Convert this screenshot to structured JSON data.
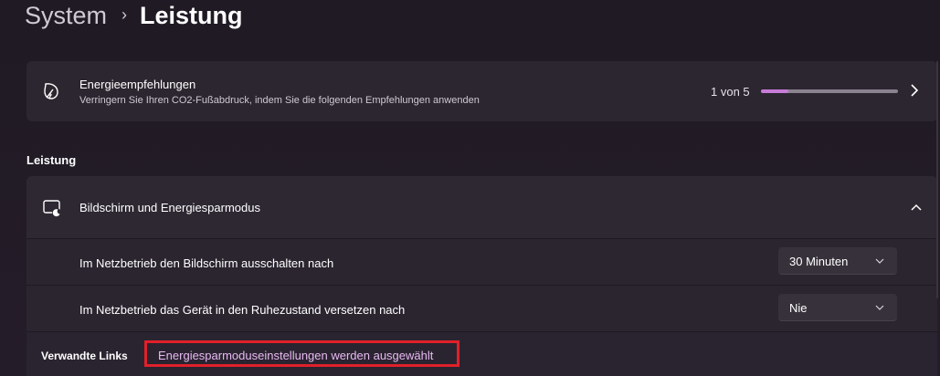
{
  "breadcrumb": {
    "parent": "System",
    "separator": "›",
    "current": "Leistung"
  },
  "recommendations": {
    "icon": "leaf-energy-icon",
    "title": "Energieempfehlungen",
    "subtitle": "Verringern Sie Ihren CO2-Fußabdruck, indem Sie die folgenden Empfehlungen anwenden",
    "count": "1 von 5",
    "progress_fraction": 0.2,
    "accent": "#c77bd8"
  },
  "section": {
    "heading": "Leistung"
  },
  "screen_power": {
    "icon": "screen-sleep-icon",
    "title": "Bildschirm und Energiesparmodus",
    "expanded": true,
    "rows": [
      {
        "label": "Im Netzbetrieb den Bildschirm ausschalten nach",
        "value": "30 Minuten"
      },
      {
        "label": "Im Netzbetrieb das Gerät in den Ruhezustand versetzen nach",
        "value": "Nie"
      }
    ]
  },
  "related": {
    "label": "Verwandte Links",
    "link": "Energiesparmoduseinstellungen werden ausgewählt",
    "highlight_color": "#e0202a"
  }
}
